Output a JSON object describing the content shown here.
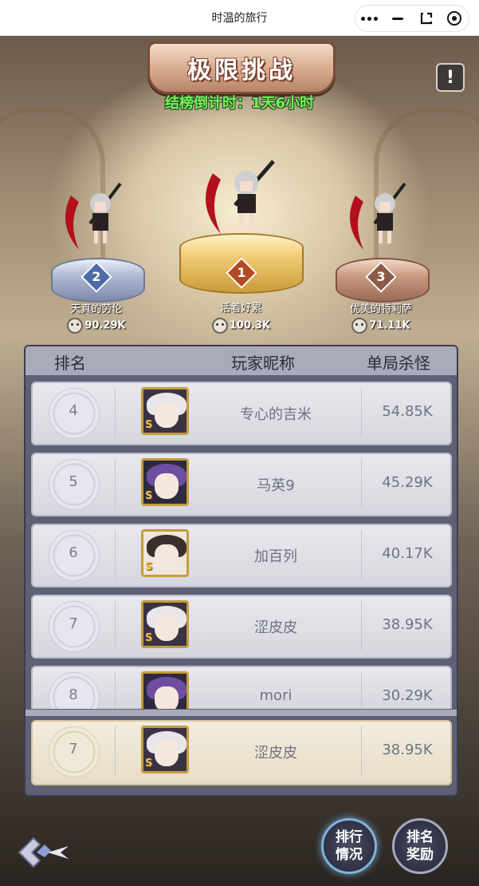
{
  "wechat": {
    "title": "时温的旅行"
  },
  "header": {
    "banner": "极限挑战",
    "info_icon_glyph": "!",
    "countdown": "结榜倒计时：1天6小时"
  },
  "podium": [
    {
      "rank": "2",
      "name": "天真的劳伦",
      "score": "90.29K",
      "color": "#4f6aa8"
    },
    {
      "rank": "1",
      "name": "活着好累",
      "score": "100.3K",
      "color": "#b24a22"
    },
    {
      "rank": "3",
      "name": "优美的特莉萨",
      "score": "71.11K",
      "color": "#8b5a47"
    }
  ],
  "table": {
    "headers": {
      "rank": "排名",
      "nickname": "玩家昵称",
      "kills": "单局杀怪"
    },
    "rows": [
      {
        "rank": "4",
        "nickname": "专心的吉米",
        "kills": "54.85K",
        "hair": "#e9e6ea",
        "avatar_icon": "s-badge"
      },
      {
        "rank": "5",
        "nickname": "马英9",
        "kills": "45.29K",
        "hair": "#6e4ea0",
        "avatar_icon": "s-badge"
      },
      {
        "rank": "6",
        "nickname": "加百列",
        "kills": "40.17K",
        "hair": "#3a2f2c",
        "avatar_icon": "s-badge"
      },
      {
        "rank": "7",
        "nickname": "涩皮皮",
        "kills": "38.95K",
        "hair": "#e9e6ea",
        "avatar_icon": "s-badge"
      },
      {
        "rank": "8",
        "nickname": "mori",
        "kills": "30.29K",
        "hair": "#6e4ea0",
        "avatar_icon": "s-badge"
      }
    ],
    "me": {
      "rank": "7",
      "nickname": "涩皮皮",
      "kills": "38.95K",
      "hair": "#e9e6ea"
    },
    "s_badge": "S"
  },
  "bottom": {
    "ranking_btn": "排行情况",
    "reward_btn": "排名奖励"
  }
}
